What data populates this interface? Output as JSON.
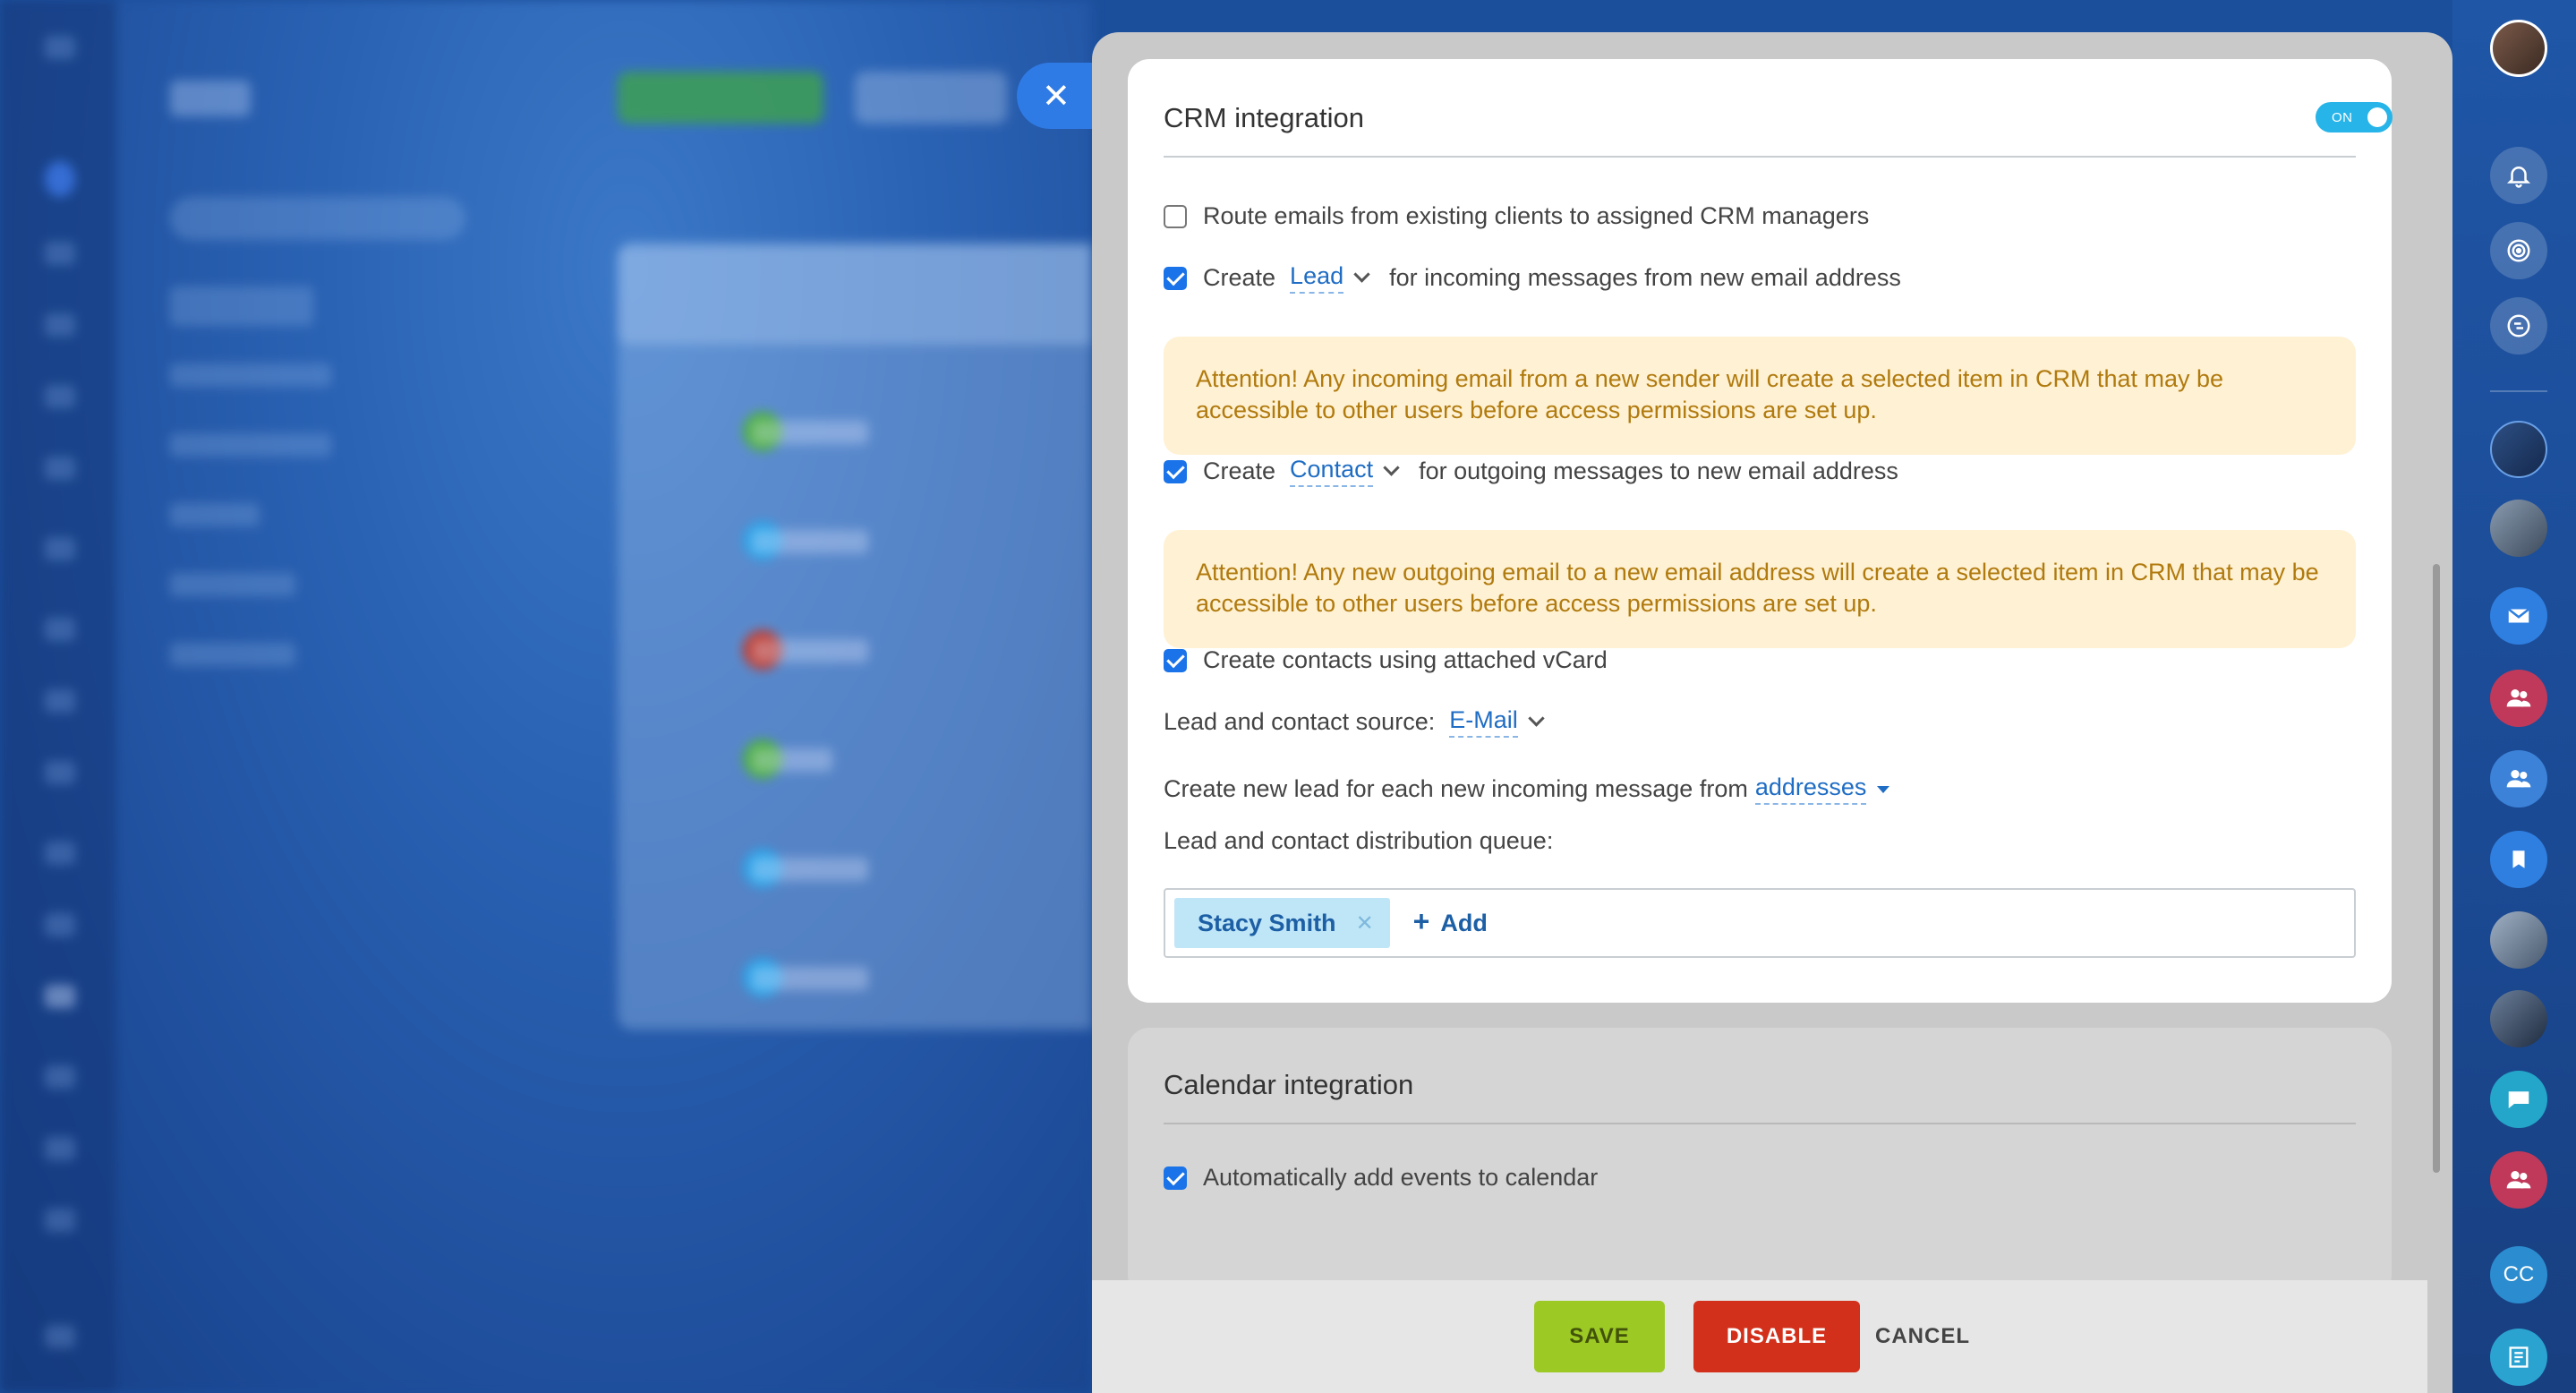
{
  "crm": {
    "title": "CRM integration",
    "toggle_label": "ON",
    "route_emails": "Route emails from existing clients to assigned CRM managers",
    "incoming": {
      "prefix": "Create",
      "entity": "Lead",
      "suffix": "for incoming messages from new email address",
      "checked": true
    },
    "incoming_warning": "Attention! Any incoming email from a new sender will create a selected item in CRM that may be accessible to other users before access permissions are set up.",
    "outgoing": {
      "prefix": "Create",
      "entity": "Contact",
      "suffix": "for outgoing messages to new email address",
      "checked": true
    },
    "outgoing_warning": "Attention! Any new outgoing email to a new email address will create a selected item in CRM that may be accessible to other users before access permissions are set up.",
    "vcard": "Create contacts using attached vCard",
    "source_label": "Lead and contact source:",
    "source_value": "E-Mail",
    "new_lead_label": "Create new lead for each new incoming message from",
    "new_lead_value": "addresses",
    "queue_label": "Lead and contact distribution queue:",
    "queue_members": [
      "Stacy Smith"
    ],
    "add_label": "Add"
  },
  "calendar": {
    "title": "Calendar integration",
    "auto_add": "Automatically add events to calendar",
    "checked": true
  },
  "footer": {
    "save": "SAVE",
    "disable": "DISABLE",
    "cancel": "CANCEL"
  },
  "right_bar": {
    "initials_badge": "CC",
    "icons": [
      "bell-icon",
      "target-icon",
      "chat-sync-icon",
      "mail-icon",
      "group-icon",
      "group-icon",
      "bookmark-icon",
      "chat-icon",
      "group-icon",
      "notes-icon"
    ]
  },
  "colors": {
    "accent": "#1a73e8",
    "save": "#9cc924",
    "disable": "#d2301b",
    "warning_bg": "#fff1d3",
    "warning_text": "#b07a0e",
    "toggle": "#27b4e8"
  }
}
